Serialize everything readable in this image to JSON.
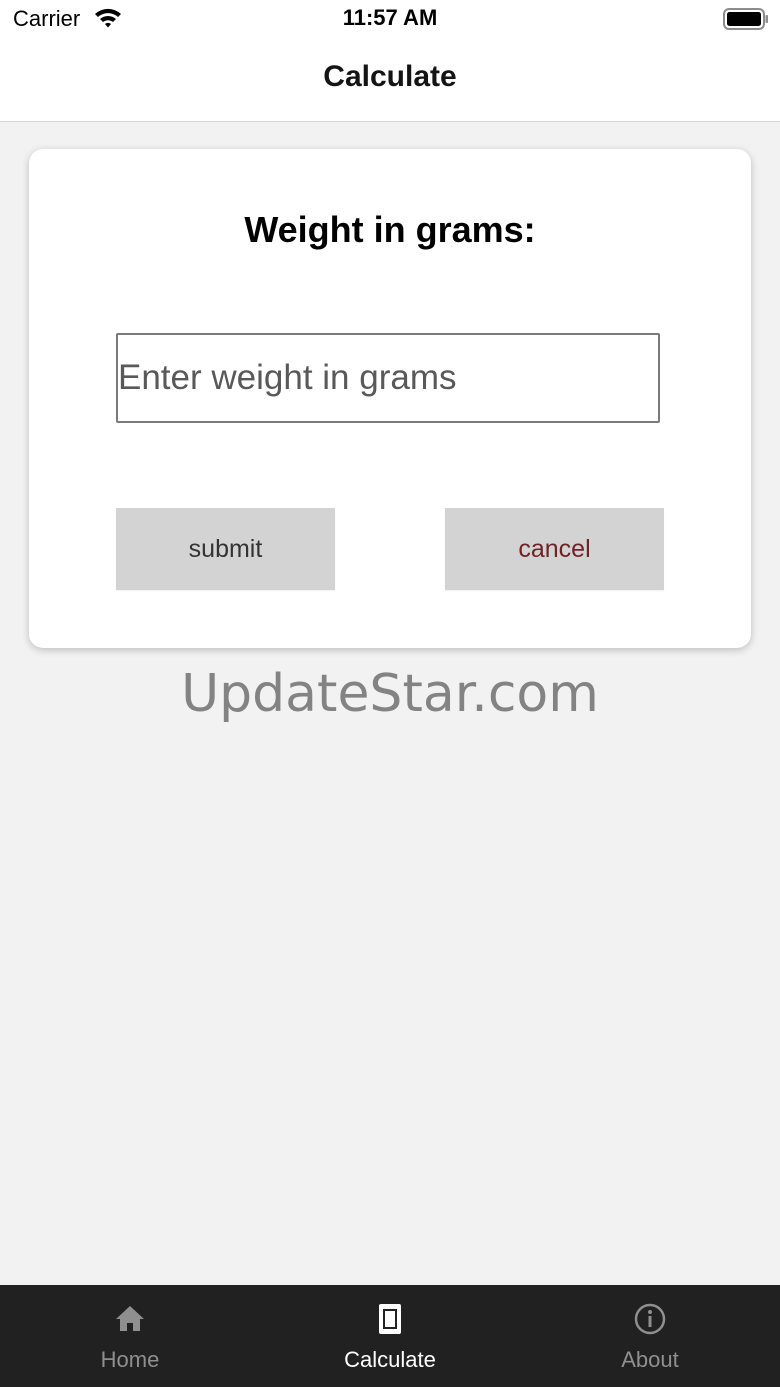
{
  "status_bar": {
    "carrier": "Carrier",
    "time": "11:57 AM",
    "wifi_icon": "wifi-icon",
    "battery_icon": "battery-full-icon"
  },
  "header": {
    "title": "Calculate"
  },
  "form": {
    "heading": "Weight in grams:",
    "weight_input": {
      "value": "",
      "placeholder": "Enter weight in grams"
    },
    "submit_label": "submit",
    "cancel_label": "cancel"
  },
  "watermark": "UpdateStar.com",
  "tab_bar": {
    "tabs": [
      {
        "label": "Home",
        "icon": "home-icon",
        "active": false
      },
      {
        "label": "Calculate",
        "icon": "calculator-icon",
        "active": true
      },
      {
        "label": "About",
        "icon": "info-icon",
        "active": false
      }
    ]
  },
  "colors": {
    "background": "#f2f2f2",
    "card": "#ffffff",
    "button": "#d3d3d3",
    "cancel_text": "#6e2327",
    "tab_bar": "#212121",
    "tab_active": "#ffffff",
    "tab_inactive": "#8f8f8f"
  }
}
